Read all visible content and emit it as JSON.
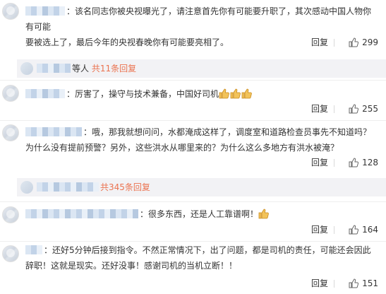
{
  "comments": [
    {
      "text_line1": "：该名同志你被央视曝光了，请注意首先你有可能要升职了，其次感动中国人物你有可能",
      "text_line2": "要被选上了，最后今年的央视春晚你有可能要亮相了。",
      "reply_label": "回复",
      "likes": "299"
    },
    {
      "text_line1": "：厉害了，操守与技术兼备，中国好司机",
      "emoji": [
        "thumbs-up-icon",
        "thumbs-up-icon",
        "thumbs-up-icon"
      ],
      "reply_label": "回复",
      "likes": "255"
    },
    {
      "text_line1": "：哦，那我就想问问，水都淹成这样了，调度室和道路检查员事先不知道吗？",
      "text_line2": "为什么没有提前预警？另外，这些洪水从哪里来的？为什么这么多地方有洪水被淹？",
      "reply_label": "回复",
      "likes": "128"
    },
    {
      "text_line1": "：很多东西，还是人工靠谱啊！",
      "emoji": [
        "thumbs-up-icon"
      ],
      "reply_label": "回复",
      "likes": "164"
    },
    {
      "text_line1": "：还好5分钟后接到指令。不然正常情况下，出了问题，都是司机的责任，可能还会因此",
      "text_line2": "辞职！这就是现实。还好没事！感谢司机的当机立断！！",
      "reply_label": "回复",
      "likes": "151"
    }
  ],
  "sub_replies": [
    {
      "prefix": "等人",
      "link": "共11条回复"
    },
    {
      "link": "共345条回复"
    }
  ],
  "colors": {
    "accent_link": "#eb7350",
    "subbar_bg": "#f2f2f5",
    "text": "#333333"
  }
}
